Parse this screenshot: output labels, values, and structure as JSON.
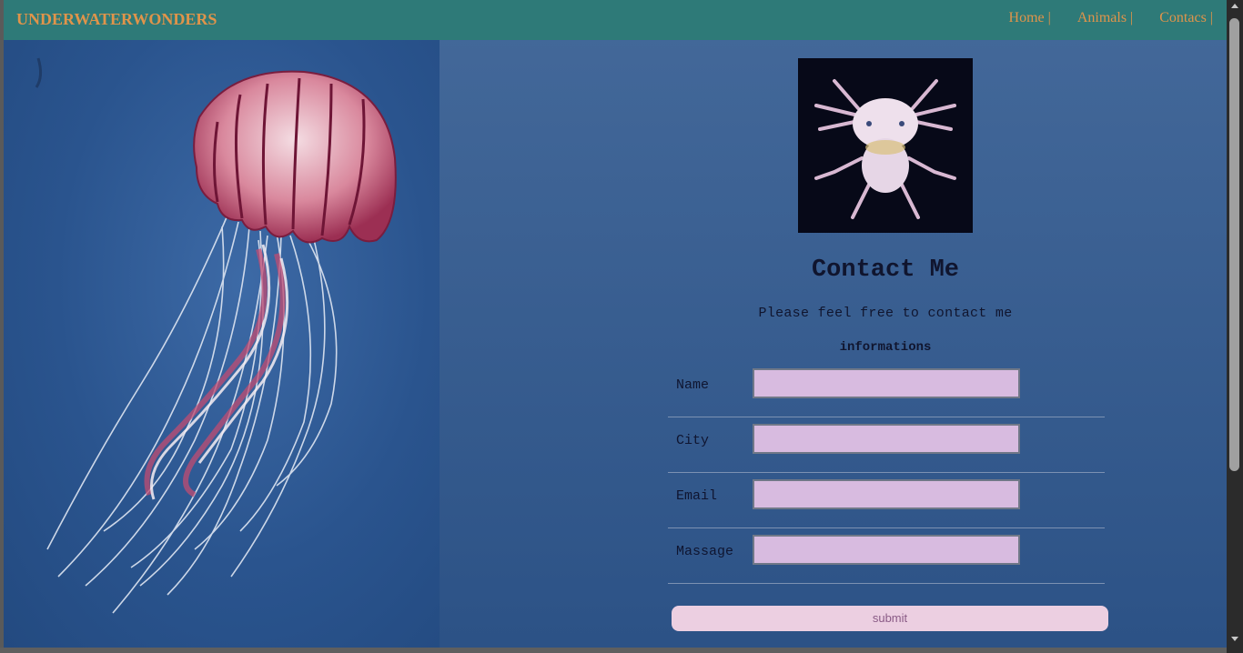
{
  "navbar": {
    "brand": "UNDERWATERWONDERS",
    "links": [
      {
        "label": "Home |"
      },
      {
        "label": "Animals |"
      },
      {
        "label": "Contacs |"
      }
    ]
  },
  "contact": {
    "title": "Contact Me",
    "subtitle": "Please feel free to contact me",
    "section_label": "informations",
    "fields": [
      {
        "label": "Name",
        "value": ""
      },
      {
        "label": "City",
        "value": ""
      },
      {
        "label": "Email",
        "value": ""
      },
      {
        "label": "Massage",
        "value": ""
      }
    ],
    "submit_label": "submit"
  },
  "images": {
    "left": "jellyfish-image",
    "profile": "axolotl-image"
  },
  "colors": {
    "navbar": "#2e7a78",
    "brand_text": "#e0944a",
    "page_background": "#3a5f94",
    "input_background": "#d8bbe0",
    "submit_background": "#eccfe1"
  }
}
